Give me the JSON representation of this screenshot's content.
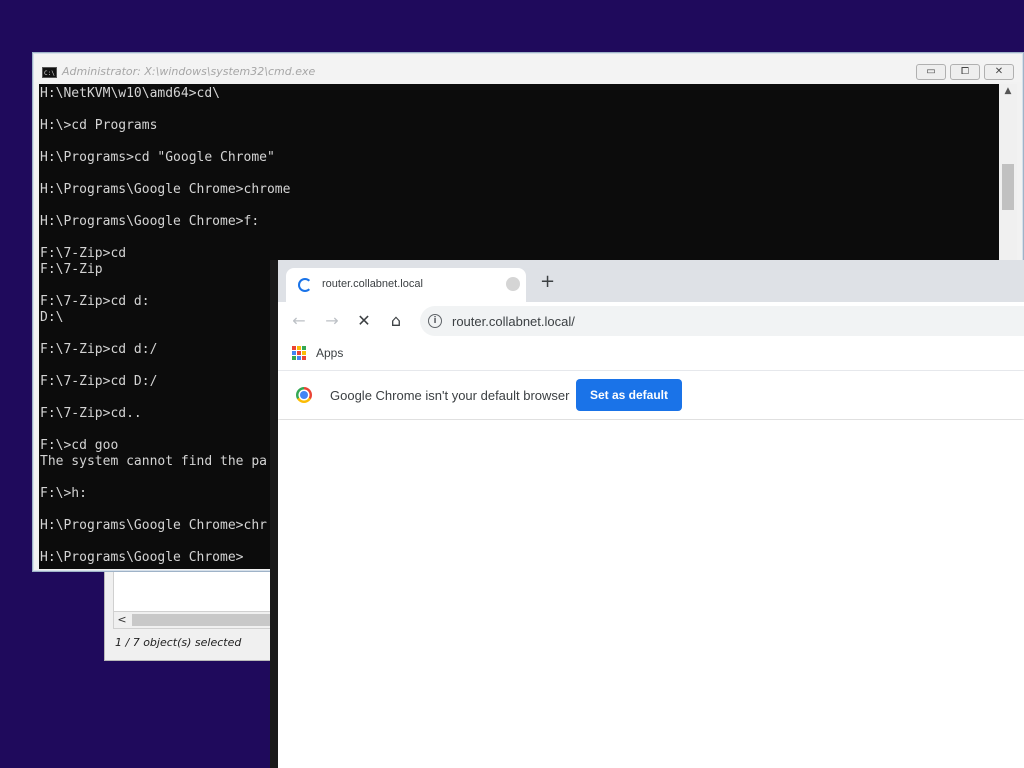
{
  "file_manager": {
    "status": "1 / 7 object(s) selected",
    "scroll_left": "<"
  },
  "cmd": {
    "title": "Administrator: X:\\windows\\system32\\cmd.exe",
    "icon_text": "C:\\",
    "buttons": {
      "minimize": "▭",
      "maximize": "⧠",
      "close": "✕"
    },
    "lines": [
      "H:\\NetKVM\\w10\\amd64>cd\\",
      "",
      "H:\\>cd Programs",
      "",
      "H:\\Programs>cd \"Google Chrome\"",
      "",
      "H:\\Programs\\Google Chrome>chrome",
      "",
      "H:\\Programs\\Google Chrome>f:",
      "",
      "F:\\7-Zip>cd",
      "F:\\7-Zip",
      "",
      "F:\\7-Zip>cd d:",
      "D:\\",
      "",
      "F:\\7-Zip>cd d:/",
      "",
      "F:\\7-Zip>cd D:/",
      "",
      "F:\\7-Zip>cd..",
      "",
      "F:\\>cd goo",
      "The system cannot find the pa",
      "",
      "F:\\>h:",
      "",
      "H:\\Programs\\Google Chrome>chr",
      "",
      "H:\\Programs\\Google Chrome>"
    ]
  },
  "chrome": {
    "tab_title": "router.collabnet.local",
    "new_tab": "+",
    "nav": {
      "back": "←",
      "forward": "→",
      "stop": "✕",
      "home": "⌂"
    },
    "url": "router.collabnet.local/",
    "info_icon": "i",
    "bookmarks": {
      "apps_label": "Apps"
    },
    "infobar": {
      "message": "Google Chrome isn't your default browser",
      "button": "Set as default"
    },
    "colors": {
      "accent": "#1a73e8",
      "apps_grid": [
        "#ea4335",
        "#fbbc05",
        "#34a853",
        "#4285f4",
        "#ea4335",
        "#fbbc05",
        "#34a853",
        "#4285f4",
        "#ea4335"
      ]
    }
  },
  "desktop": {
    "background": "#1f0a5c"
  }
}
